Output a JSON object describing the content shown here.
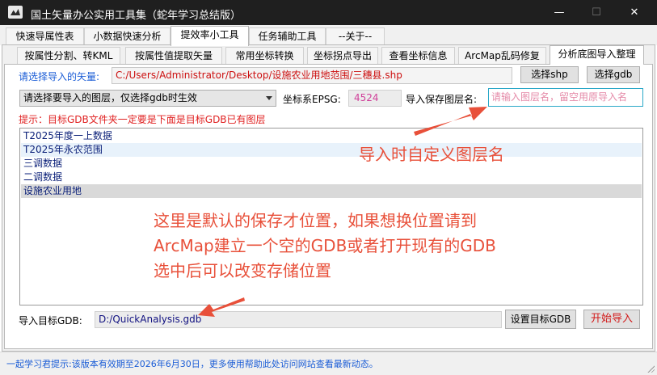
{
  "window": {
    "title": "国土矢量办公实用工具集（蛇年学习总结版）",
    "minimize": "—",
    "maximize": "☐",
    "close": "✕"
  },
  "main_tabs": [
    "快速导属性表",
    "小数据快速分析",
    "提效率小工具",
    "任务辅助工具",
    "--关于--"
  ],
  "sub_tabs": [
    "按属性分割、转KML",
    "按属性值提取矢量",
    "常用坐标转换",
    "坐标拐点导出",
    "查看坐标信息",
    "ArcMap乱码修复",
    "分析底图导入整理"
  ],
  "form": {
    "vector_label": "请选择导入的矢量:",
    "vector_path": "C:/Users/Administrator/Desktop/设施农业用地范围/三穗县.shp",
    "btn_select_shp": "选择shp",
    "btn_select_gdb": "选择gdb",
    "layer_select": "请选择要导入的图层，仅选择gdb时生效",
    "epsg_label": "坐标系EPSG:",
    "epsg_value": "4524",
    "save_name_label": "导入保存图层名:",
    "save_name_placeholder": "请输入图层名，留空用原导入名",
    "hint": "提示：目标GDB文件夹一定要是下面是目标GDB已有图层",
    "gdb_label": "导入目标GDB:",
    "gdb_path": "D:/QuickAnalysis.gdb",
    "btn_set_gdb": "设置目标GDB",
    "btn_start": "开始导入"
  },
  "layers": [
    "T2025年度一上数据",
    "T2025年永农范围",
    "三调数据",
    "二调数据",
    "设施农业用地"
  ],
  "annotations": {
    "custom_name": "导入时自定义图层名",
    "default_location": [
      "这里是默认的保存才位置，如果想换位置请到",
      "ArcMap建立一个空的GDB或者打开现有的GDB",
      "选中后可以改变存储位置"
    ]
  },
  "status": "一起学习君提示:该版本有效期至2026年6月30日，更多使用帮助此处访问网站查看最新动态。",
  "colors": {
    "accent_blue": "#1a5cd6",
    "annotation_red": "#e8503a",
    "path_red": "#cc1010",
    "epsg_pink": "#d0409a",
    "input_border": "#2aa8c8"
  }
}
